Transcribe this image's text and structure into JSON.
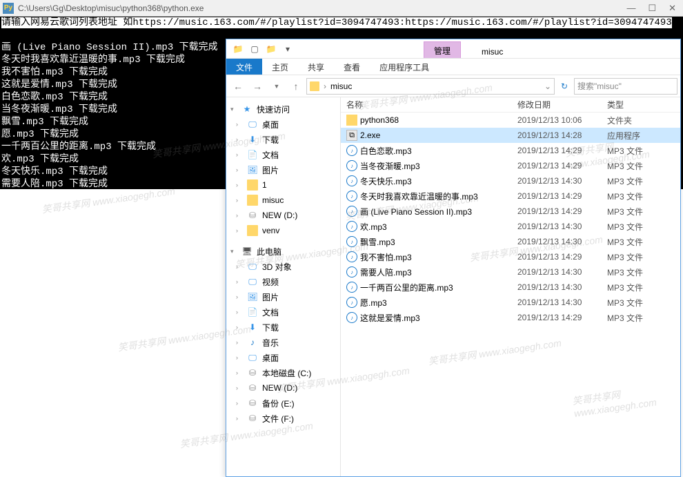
{
  "console": {
    "title": "C:\\Users\\Gg\\Desktop\\misuc\\python368\\python.exe",
    "prompt": "请输入网易云歌词列表地址 如https://music.163.com/#/playlist?id=3094747493:https://music.163.com/#/playlist?id=3094747493",
    "lines": [
      "",
      "画 (Live Piano Session II).mp3 下载完成",
      "冬天时我喜欢靠近温暖的事.mp3 下载完成",
      "我不害怕.mp3 下载完成",
      "这就是爱情.mp3 下载完成",
      "白色恋歌.mp3 下载完成",
      "当冬夜渐暖.mp3 下载完成",
      "飘雪.mp3 下载完成",
      "愿.mp3 下载完成",
      "一千两百公里的距离.mp3 下载完成",
      "欢.mp3 下载完成",
      "冬天快乐.mp3 下载完成",
      "需要人陪.mp3 下载完成"
    ]
  },
  "explorer": {
    "topTabs": {
      "manage": "管理",
      "current": "misuc"
    },
    "ribbon": {
      "file": "文件",
      "home": "主页",
      "share": "共享",
      "view": "查看",
      "apptools": "应用程序工具"
    },
    "crumb": "misuc",
    "searchPlaceholder": "搜索\"misuc\"",
    "headers": {
      "name": "名称",
      "date": "修改日期",
      "type": "类型"
    },
    "sidebar": {
      "quick": "快速访问",
      "items1": [
        {
          "label": "桌面",
          "ic": "desktop"
        },
        {
          "label": "下载",
          "ic": "dl"
        },
        {
          "label": "文档",
          "ic": "doc"
        },
        {
          "label": "图片",
          "ic": "img"
        },
        {
          "label": "1",
          "ic": "folder"
        },
        {
          "label": "misuc",
          "ic": "folder"
        },
        {
          "label": "NEW (D:)",
          "ic": "drive"
        },
        {
          "label": "venv",
          "ic": "folder"
        }
      ],
      "pc": "此电脑",
      "items2": [
        {
          "label": "3D 对象",
          "ic": "desktop"
        },
        {
          "label": "视频",
          "ic": "desktop"
        },
        {
          "label": "图片",
          "ic": "img"
        },
        {
          "label": "文档",
          "ic": "doc"
        },
        {
          "label": "下载",
          "ic": "dl"
        },
        {
          "label": "音乐",
          "ic": "music"
        },
        {
          "label": "桌面",
          "ic": "desktop"
        },
        {
          "label": "本地磁盘 (C:)",
          "ic": "drive"
        },
        {
          "label": "NEW (D:)",
          "ic": "drive"
        },
        {
          "label": "备份 (E:)",
          "ic": "drive"
        },
        {
          "label": "文件 (F:)",
          "ic": "drive"
        }
      ]
    },
    "files": [
      {
        "name": "python368",
        "date": "2019/12/13 10:06",
        "type": "文件夹",
        "ic": "folder"
      },
      {
        "name": "2.exe",
        "date": "2019/12/13 14:28",
        "type": "应用程序",
        "ic": "exe",
        "sel": true
      },
      {
        "name": "白色恋歌.mp3",
        "date": "2019/12/13 14:29",
        "type": "MP3 文件",
        "ic": "mp3"
      },
      {
        "name": "当冬夜渐暖.mp3",
        "date": "2019/12/13 14:29",
        "type": "MP3 文件",
        "ic": "mp3"
      },
      {
        "name": "冬天快乐.mp3",
        "date": "2019/12/13 14:30",
        "type": "MP3 文件",
        "ic": "mp3"
      },
      {
        "name": "冬天时我喜欢靠近温暖的事.mp3",
        "date": "2019/12/13 14:29",
        "type": "MP3 文件",
        "ic": "mp3"
      },
      {
        "name": "画 (Live Piano Session II).mp3",
        "date": "2019/12/13 14:29",
        "type": "MP3 文件",
        "ic": "mp3"
      },
      {
        "name": "欢.mp3",
        "date": "2019/12/13 14:30",
        "type": "MP3 文件",
        "ic": "mp3"
      },
      {
        "name": "飘雪.mp3",
        "date": "2019/12/13 14:30",
        "type": "MP3 文件",
        "ic": "mp3"
      },
      {
        "name": "我不害怕.mp3",
        "date": "2019/12/13 14:29",
        "type": "MP3 文件",
        "ic": "mp3"
      },
      {
        "name": "需要人陪.mp3",
        "date": "2019/12/13 14:30",
        "type": "MP3 文件",
        "ic": "mp3"
      },
      {
        "name": "一千两百公里的距离.mp3",
        "date": "2019/12/13 14:30",
        "type": "MP3 文件",
        "ic": "mp3"
      },
      {
        "name": "愿.mp3",
        "date": "2019/12/13 14:30",
        "type": "MP3 文件",
        "ic": "mp3"
      },
      {
        "name": "这就是爱情.mp3",
        "date": "2019/12/13 14:29",
        "type": "MP3 文件",
        "ic": "mp3"
      }
    ]
  },
  "watermark": "笑哥共享网 www.xiaogegh.com"
}
